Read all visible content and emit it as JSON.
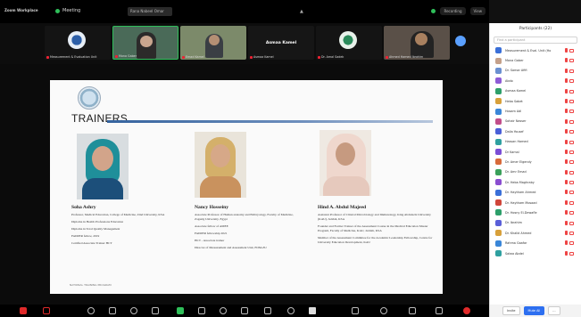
{
  "topbar": {
    "app_label": "Zoom Workplace",
    "meeting_label": "Meeting",
    "tab_title": "Rana Nabeel Omar",
    "recording_label": "Recording",
    "view_label": "View"
  },
  "thumbnails": [
    {
      "name": "Measurement & Evaluation Unit"
    },
    {
      "name": "Mona Gaber"
    },
    {
      "name": "Emad Kamel"
    },
    {
      "name": "Asmaa Kamel",
      "center_text": "Asmaa Kamel"
    },
    {
      "name": "Dr. Amal Sadek"
    },
    {
      "name": "Ahmed Hamed Ibrahim"
    }
  ],
  "slide": {
    "title": "TRAINERS",
    "footer": "NATIONAL TRAINING PROGRAM",
    "trainers": [
      {
        "name": "Soha Ashry",
        "lines": [
          "Professor, Medical Education, College of Medicine, Zind University, KSA",
          "Diploma in Health Professions Education",
          "Diploma in Total Quality Management",
          "FAIMER fellow, 2019",
          "Certified Associate Trainer HCT"
        ]
      },
      {
        "name": "Nancy Hosseiny",
        "lines": [
          "Associate Professor of Human anatomy and Embryology, Faculty of Medicine, Zagazig University, Egypt",
          "Associate fellow of AMEE",
          "FAIMER fellowship 2021",
          "HCT - Associate trainer",
          "Director of Measurement and Assessment Unit, FOM-ZU"
        ]
      },
      {
        "name": "Hind A. Abdul Majeed",
        "lines": [
          "Assistant Professor of Clinical Microbiology and Immunology, King Abdulaziz University (KAU), Jeddah, KSA",
          "Founder and Former Trainer of the Assessment Course in the Medical Education Master Program, Faculty of Medicine, KAU, Jeddah, KSA",
          "Member of the Assessment Committee for the Academic Leadership Fellowship, Centre for University Education Development, KAU"
        ]
      }
    ]
  },
  "participants": {
    "title": "Participants (22)",
    "search_placeholder": "Find a participant",
    "items": [
      {
        "name": "Measurement & Eval. Unit (Ho",
        "color": "#3a6fd8"
      },
      {
        "name": "Mona Gaber",
        "color": "#c4a08a"
      },
      {
        "name": "Dr. Samar Afifi",
        "color": "#6a8fd0"
      },
      {
        "name": "Abdo",
        "color": "#8e5bd6"
      },
      {
        "name": "Asmaa Kamel",
        "color": "#2d9f6a"
      },
      {
        "name": "Heba Sabet",
        "color": "#d8a03a"
      },
      {
        "name": "Hosam Adl",
        "color": "#3a86d8"
      },
      {
        "name": "Sohair Nasser",
        "color": "#c24d8a"
      },
      {
        "name": "Dalia Yousef",
        "color": "#4a5fd8"
      },
      {
        "name": "Hassan Hamed",
        "color": "#2fa0a0"
      },
      {
        "name": "Dr Kamal",
        "color": "#7a4dd6"
      },
      {
        "name": "Dr. Amer Elgendy",
        "color": "#d86a3a"
      },
      {
        "name": "Dr. Amr Emad",
        "color": "#3aa05a"
      },
      {
        "name": "Dr. Heba Maghraby",
        "color": "#8a4dd0"
      },
      {
        "name": "Dr. Haytham Ahmed",
        "color": "#3a6fd8"
      },
      {
        "name": "Dr. Haytham Mosaad",
        "color": "#d0463a"
      },
      {
        "name": "Dr. Hosny El-Dewafle",
        "color": "#2d9f6a"
      },
      {
        "name": "Dr. Ibrahim",
        "color": "#5a5fd8"
      },
      {
        "name": "Dr. Khalid Ahmed",
        "color": "#d8a03a"
      },
      {
        "name": "Rahma Gaafar",
        "color": "#3a86d8"
      },
      {
        "name": "Salwa Abdel",
        "color": "#2fa0a0"
      }
    ],
    "invite_label": "Invite",
    "mute_label": "Mute All",
    "more_label": "..."
  },
  "colors": {
    "accent": "#2d6ff0",
    "end_call": "#e02a2a",
    "slide_rule": "#35639e"
  }
}
